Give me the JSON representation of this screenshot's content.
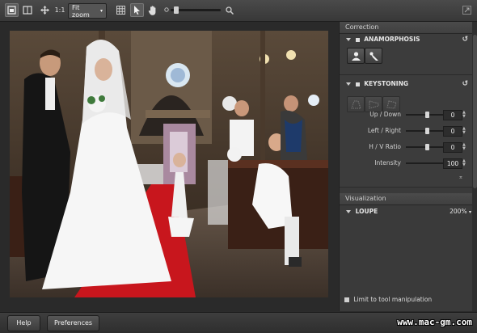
{
  "toolbar": {
    "zoom_ratio_label": "1:1",
    "zoom_select_value": "Fit zoom",
    "zoom_slider_level": 0.08
  },
  "panel": {
    "correction_title": "Correction",
    "anamorphosis": {
      "title": "ANAMORPHOSIS"
    },
    "keystoning": {
      "title": "KEYSTONING",
      "rows": [
        {
          "label": "Up / Down",
          "value": "0",
          "level": 0.5
        },
        {
          "label": "Left / Right",
          "value": "0",
          "level": 0.5
        },
        {
          "label": "H / V Ratio",
          "value": "0",
          "level": 0.5
        },
        {
          "label": "Intensity",
          "value": "100",
          "level": 1.0
        }
      ]
    },
    "visualization_title": "Visualization",
    "loupe": {
      "title": "LOUPE",
      "zoom": "200%"
    },
    "limit_checkbox_label": "Limit to tool manipulation"
  },
  "bottom": {
    "help_label": "Help",
    "preferences_label": "Preferences",
    "watermark": "www.mac-gm.com"
  },
  "colors": {
    "carpet": "#c8161d",
    "panel_bg": "#3a3a3a",
    "toolbar_bg": "#404040"
  }
}
